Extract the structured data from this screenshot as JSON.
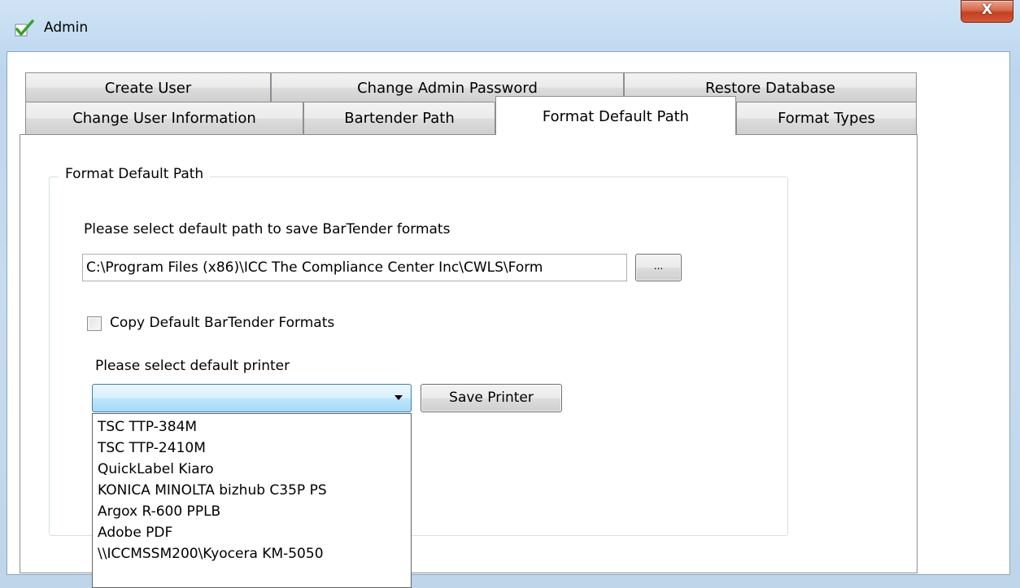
{
  "window": {
    "title": "Admin",
    "close_label": "X"
  },
  "tabs": {
    "row1": [
      {
        "label": "Create User"
      },
      {
        "label": "Change Admin Password"
      },
      {
        "label": "Restore Database"
      }
    ],
    "row2": [
      {
        "label": "Change User Information"
      },
      {
        "label": "Bartender Path"
      },
      {
        "label": "Format Default Path",
        "selected": true
      },
      {
        "label": "Format Types"
      }
    ]
  },
  "group": {
    "title": "Format Default Path"
  },
  "path_section": {
    "prompt": "Please select default path to save BarTender formats",
    "path_value": "C:\\Program Files (x86)\\ICC The Compliance Center Inc\\CWLS\\Form",
    "browse_label": "..."
  },
  "copy_option": {
    "label": "Copy Default BarTender Formats",
    "checked": false
  },
  "printer_section": {
    "prompt": "Please select default printer",
    "selected_value": "",
    "save_label": "Save Printer",
    "options": [
      "TSC TTP-384M",
      "TSC TTP-2410M",
      "QuickLabel Kiaro",
      "KONICA MINOLTA bizhub C35P PS",
      "Argox R-600 PPLB",
      "Adobe PDF",
      "\\\\ICCMSSM200\\Kyocera KM-5050"
    ]
  },
  "colors": {
    "combo_border": "#3c7fb1",
    "close_button": "#c4401f",
    "window_frame": "#bcd6ee"
  }
}
